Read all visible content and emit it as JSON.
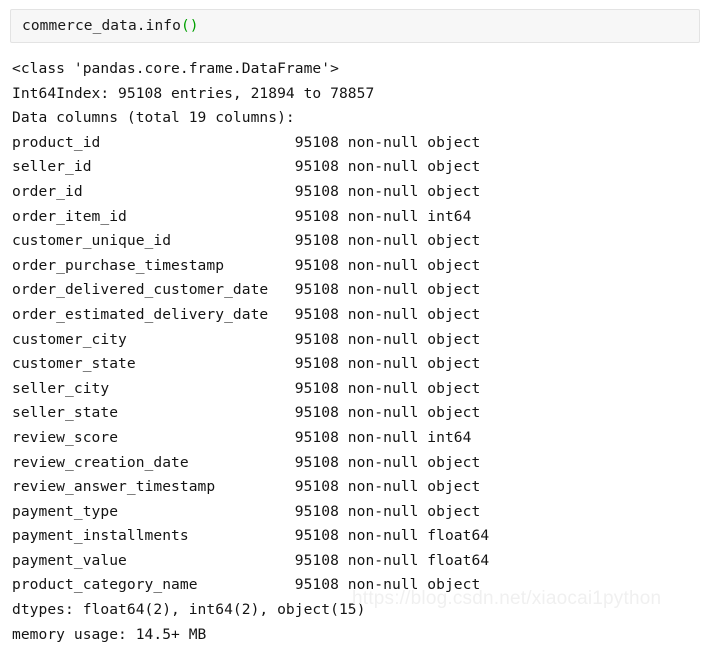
{
  "cell": {
    "input_code_main": "commerce_data.info",
    "input_code_parens": "()"
  },
  "output": {
    "header_lines": [
      "<class 'pandas.core.frame.DataFrame'>",
      "Int64Index: 95108 entries, 21894 to 78857",
      "Data columns (total 19 columns):"
    ],
    "columns": [
      {
        "name": "product_id",
        "count": "95108",
        "nonnull": "non-null",
        "dtype": "object"
      },
      {
        "name": "seller_id",
        "count": "95108",
        "nonnull": "non-null",
        "dtype": "object"
      },
      {
        "name": "order_id",
        "count": "95108",
        "nonnull": "non-null",
        "dtype": "object"
      },
      {
        "name": "order_item_id",
        "count": "95108",
        "nonnull": "non-null",
        "dtype": "int64"
      },
      {
        "name": "customer_unique_id",
        "count": "95108",
        "nonnull": "non-null",
        "dtype": "object"
      },
      {
        "name": "order_purchase_timestamp",
        "count": "95108",
        "nonnull": "non-null",
        "dtype": "object"
      },
      {
        "name": "order_delivered_customer_date",
        "count": "95108",
        "nonnull": "non-null",
        "dtype": "object"
      },
      {
        "name": "order_estimated_delivery_date",
        "count": "95108",
        "nonnull": "non-null",
        "dtype": "object"
      },
      {
        "name": "customer_city",
        "count": "95108",
        "nonnull": "non-null",
        "dtype": "object"
      },
      {
        "name": "customer_state",
        "count": "95108",
        "nonnull": "non-null",
        "dtype": "object"
      },
      {
        "name": "seller_city",
        "count": "95108",
        "nonnull": "non-null",
        "dtype": "object"
      },
      {
        "name": "seller_state",
        "count": "95108",
        "nonnull": "non-null",
        "dtype": "object"
      },
      {
        "name": "review_score",
        "count": "95108",
        "nonnull": "non-null",
        "dtype": "int64"
      },
      {
        "name": "review_creation_date",
        "count": "95108",
        "nonnull": "non-null",
        "dtype": "object"
      },
      {
        "name": "review_answer_timestamp",
        "count": "95108",
        "nonnull": "non-null",
        "dtype": "object"
      },
      {
        "name": "payment_type",
        "count": "95108",
        "nonnull": "non-null",
        "dtype": "object"
      },
      {
        "name": "payment_installments",
        "count": "95108",
        "nonnull": "non-null",
        "dtype": "float64"
      },
      {
        "name": "payment_value",
        "count": "95108",
        "nonnull": "non-null",
        "dtype": "float64"
      },
      {
        "name": "product_category_name",
        "count": "95108",
        "nonnull": "non-null",
        "dtype": "object"
      }
    ],
    "footer_lines": [
      "dtypes: float64(2), int64(2), object(15)",
      "memory usage: 14.5+ MB"
    ]
  },
  "watermark": {
    "text": "https://blog.csdn.net/xiaocai1python"
  },
  "theme": {
    "input_background": "#f7f7f7",
    "input_border": "#e3e3e3",
    "text_color": "#141414",
    "paren_color": "#00a000",
    "watermark_color": "#f0f0f0"
  }
}
